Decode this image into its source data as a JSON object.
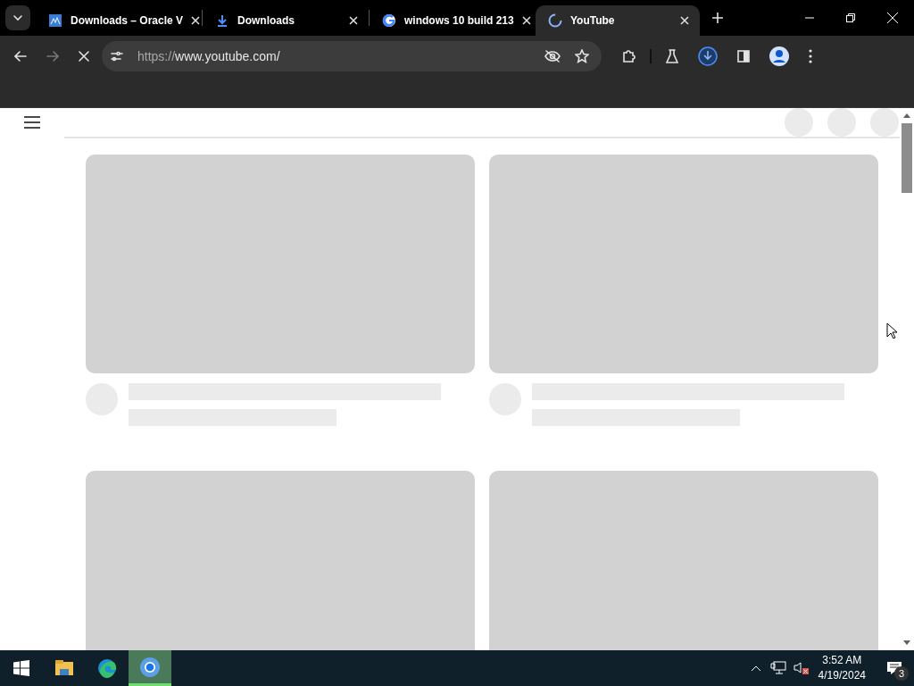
{
  "tabs": [
    {
      "title": "Downloads – Oracle V",
      "kind": "vbox",
      "selected": false
    },
    {
      "title": "Downloads",
      "kind": "download",
      "selected": false
    },
    {
      "title": "windows 10 build 213",
      "kind": "google",
      "selected": false
    },
    {
      "title": "YouTube",
      "kind": "loading",
      "selected": true
    }
  ],
  "toolbar": {
    "url_scheme": "https://",
    "url_host": "www.youtube.com/",
    "loading": true
  },
  "page": {
    "cards": [
      {
        "kind": "video-placeholder"
      },
      {
        "kind": "video-placeholder"
      },
      {
        "kind": "thumbnail-only"
      },
      {
        "kind": "thumbnail-only"
      }
    ]
  },
  "taskbar": {
    "apps": [
      {
        "kind": "explorer",
        "active": false
      },
      {
        "kind": "edge",
        "active": false
      },
      {
        "kind": "chrome",
        "active": true
      }
    ],
    "time": "3:52 AM",
    "date": "4/19/2024",
    "notifications": "3"
  }
}
